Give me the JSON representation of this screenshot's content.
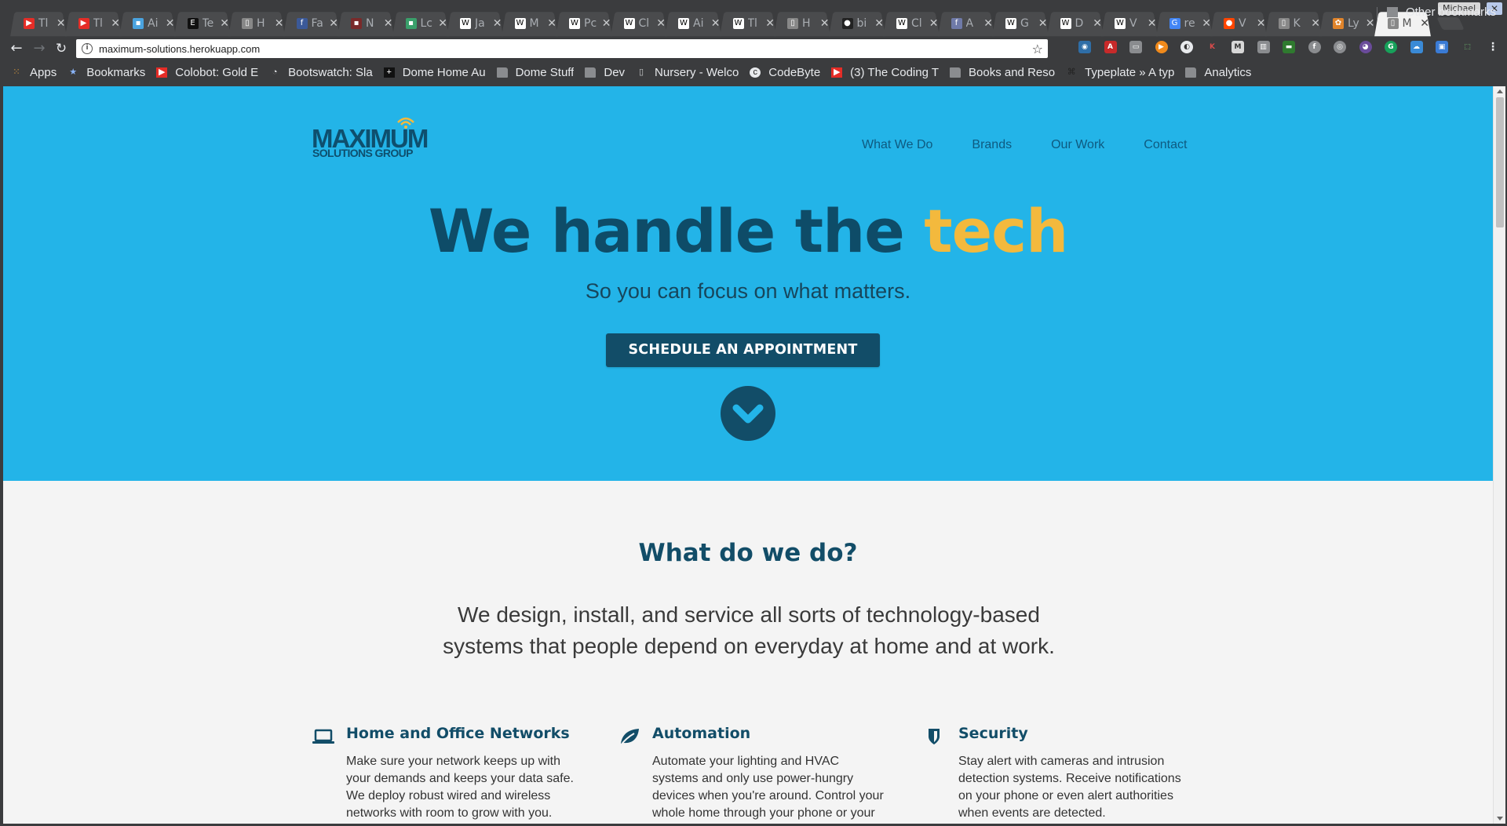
{
  "browser": {
    "tabs": [
      {
        "icon": "youtube-icon",
        "label": "Tl",
        "color": "#e52d27",
        "glyph": "▶"
      },
      {
        "icon": "youtube-icon",
        "label": "Tl",
        "color": "#e52d27",
        "glyph": "▶"
      },
      {
        "icon": "app-icon",
        "label": "Ai",
        "color": "#4aa3df",
        "glyph": "▪"
      },
      {
        "icon": "e-icon",
        "label": "Te",
        "color": "#111111",
        "glyph": "E"
      },
      {
        "icon": "page-icon",
        "label": "H",
        "color": "#888888",
        "glyph": "▯"
      },
      {
        "icon": "facebook-icon",
        "label": "Fa",
        "color": "#3b5998",
        "glyph": "f"
      },
      {
        "icon": "site-icon",
        "label": "N",
        "color": "#7a2a2a",
        "glyph": "▪"
      },
      {
        "icon": "site-icon",
        "label": "Lc",
        "color": "#3aa06b",
        "glyph": "▪"
      },
      {
        "icon": "wikipedia-icon",
        "label": "Ja",
        "color": "#ffffff",
        "glyph": "W"
      },
      {
        "icon": "wikipedia-icon",
        "label": "M",
        "color": "#ffffff",
        "glyph": "W"
      },
      {
        "icon": "wikipedia-icon",
        "label": "Pc",
        "color": "#ffffff",
        "glyph": "W"
      },
      {
        "icon": "wikipedia-icon",
        "label": "Cl",
        "color": "#ffffff",
        "glyph": "W"
      },
      {
        "icon": "wikipedia-icon",
        "label": "Ai",
        "color": "#ffffff",
        "glyph": "W"
      },
      {
        "icon": "wikipedia-icon",
        "label": "Tl",
        "color": "#ffffff",
        "glyph": "W"
      },
      {
        "icon": "page-icon",
        "label": "H",
        "color": "#888888",
        "glyph": "▯"
      },
      {
        "icon": "github-icon",
        "label": "bi",
        "color": "#222222",
        "glyph": "●"
      },
      {
        "icon": "wikipedia-icon",
        "label": "Cl",
        "color": "#ffffff",
        "glyph": "W"
      },
      {
        "icon": "site-icon",
        "label": "A",
        "color": "#6f7aa8",
        "glyph": "f"
      },
      {
        "icon": "wikipedia-icon",
        "label": "G",
        "color": "#ffffff",
        "glyph": "W"
      },
      {
        "icon": "wikipedia-icon",
        "label": "D",
        "color": "#ffffff",
        "glyph": "W"
      },
      {
        "icon": "wikipedia-icon",
        "label": "V",
        "color": "#ffffff",
        "glyph": "W"
      },
      {
        "icon": "google-icon",
        "label": "re",
        "color": "#4285f4",
        "glyph": "G"
      },
      {
        "icon": "reddit-icon",
        "label": "V",
        "color": "#ff4500",
        "glyph": "●"
      },
      {
        "icon": "page-icon",
        "label": "K",
        "color": "#888888",
        "glyph": "▯"
      },
      {
        "icon": "site-icon",
        "label": "Ly",
        "color": "#e0842b",
        "glyph": "✿"
      },
      {
        "icon": "page-icon",
        "label": "M",
        "color": "#888888",
        "glyph": "▯",
        "active": true
      }
    ],
    "profile_name": "Michael",
    "url": "maximum-solutions.herokuapp.com",
    "bookmarks": [
      {
        "icon": "apps-icon",
        "label": "Apps"
      },
      {
        "icon": "star-icon",
        "label": "Bookmarks"
      },
      {
        "icon": "youtube-icon",
        "label": "Colobot: Gold E"
      },
      {
        "icon": "bootswatch-icon",
        "label": "Bootswatch: Sla"
      },
      {
        "icon": "plus-icon",
        "label": "Dome Home Au"
      },
      {
        "icon": "folder-icon",
        "label": "Dome Stuff"
      },
      {
        "icon": "folder-icon",
        "label": "Dev"
      },
      {
        "icon": "page-icon",
        "label": "Nursery - Welco"
      },
      {
        "icon": "codebyte-icon",
        "label": "CodeByte"
      },
      {
        "icon": "youtube-icon",
        "label": "(3) The Coding T"
      },
      {
        "icon": "folder-icon",
        "label": "Books and Reso"
      },
      {
        "icon": "typeplate-icon",
        "label": "Typeplate » A typ"
      },
      {
        "icon": "folder-icon",
        "label": "Analytics"
      }
    ],
    "other_bookmarks": "Other bookmarks"
  },
  "site": {
    "logo": {
      "line1": "MAXIMUM",
      "line2": "SOLUTIONS GROUP"
    },
    "nav": [
      "What We Do",
      "Brands",
      "Our Work",
      "Contact"
    ],
    "hero": {
      "headline_main": "We handle the",
      "headline_accent": "tech",
      "subheadline": "So you can focus on what matters.",
      "cta": "SCHEDULE AN APPOINTMENT"
    },
    "section_title": "What do we do?",
    "section_description": "We design, install, and service all sorts of technology-based systems that people depend on everyday at home and at work.",
    "services": [
      {
        "icon": "laptop-icon",
        "title": "Home and Office Networks",
        "body": "Make sure your network keeps up with your demands and keeps your data safe. We deploy robust wired and wireless networks with room to grow with you."
      },
      {
        "icon": "leaf-icon",
        "title": "Automation",
        "body": "Automate your lighting and HVAC systems and only use power-hungry devices when you're around. Control your whole home through your phone or your voice."
      },
      {
        "icon": "shield-icon",
        "title": "Security",
        "body": "Stay alert with cameras and intrusion detection systems. Receive notifications on your phone or even alert authorities when events are detected."
      }
    ]
  },
  "colors": {
    "hero_bg": "#23b4e8",
    "brand_dark": "#124d68",
    "accent": "#f3b93d",
    "page_bg": "#f4f4f4"
  }
}
